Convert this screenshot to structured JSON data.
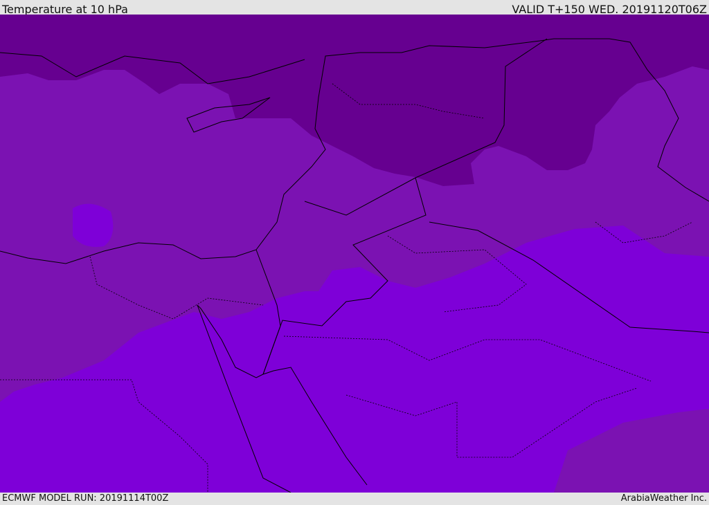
{
  "header": {
    "title": "Temperature at 10 hPa",
    "valid": "VALID T+150 WED. 20191120T06Z"
  },
  "footer": {
    "model_run": "ECMWF MODEL RUN: 20191114T00Z",
    "credit": "ArabiaWeather Inc."
  },
  "colors": {
    "cold": "#660090",
    "mid": "#7b12b2",
    "warm": "#7e00d8",
    "border": "#000000"
  }
}
